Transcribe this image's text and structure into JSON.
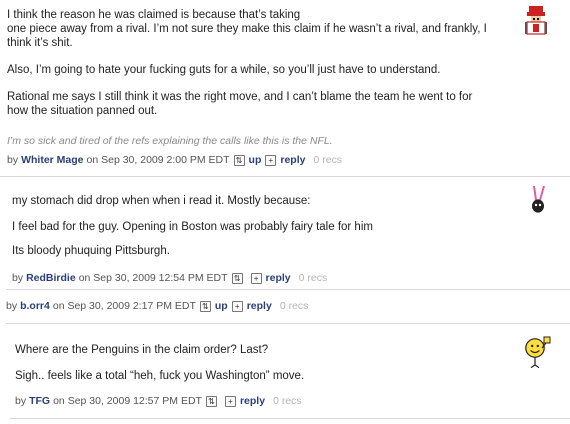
{
  "comments": [
    {
      "paragraphs": [
        "I think the reason he was claimed is because that’s taking",
        "one piece away from a rival. I’m not sure they make this claim if he wasn’t a rival, and frankly, I",
        "think it’s shit.",
        "Also, I’m going to hate your fucking guts for a while, so you’ll just have to understand.",
        "Rational me says I still think it was the right move, and I can’t blame the team he went to for",
        "how the situation panned out."
      ],
      "signature": "I’m so sick and tired of the refs explaining the calls like this is the NFL.",
      "meta": {
        "by": "by",
        "author": "Whiter Mage",
        "date": "on Sep 30, 2009 2:00 PM EDT",
        "up_icon": "⇅",
        "up": "up",
        "reply_icon": "+",
        "reply": "reply",
        "recs": "0 recs"
      },
      "avatar_icon": "pixel-mage-avatar-icon"
    },
    {
      "paragraphs": [
        "my stomach did drop when when i read it. Mostly because:",
        "I feel bad for the guy. Opening in Boston was probably fairy tale for him",
        "Its bloody phuquing Pittsburgh."
      ],
      "meta": {
        "by": "by",
        "author": "RedBirdie",
        "date": "on Sep 30, 2009 12:54 PM EDT",
        "up_icon": "⇅",
        "reply_icon": "+",
        "reply": "reply",
        "recs": "0 recs"
      },
      "avatar_icon": "pink-bunny-avatar-icon"
    },
    {
      "meta": {
        "by": "by",
        "author": "b.orr4",
        "date": "on Sep 30, 2009 2:17 PM EDT",
        "up_icon": "⇅",
        "up": "up",
        "reply_icon": "+",
        "reply": "reply",
        "recs": "0 recs"
      }
    },
    {
      "paragraphs": [
        "Where are the Penguins in the claim order? Last?",
        "Sigh.. feels like a total “heh, fuck you Washington” move."
      ],
      "meta": {
        "by": "by",
        "author": "TFG",
        "date": "on Sep 30, 2009 12:57 PM EDT",
        "up_icon": "⇅",
        "reply_icon": "+",
        "reply": "reply",
        "recs": "0 recs"
      },
      "avatar_icon": "smiley-fist-avatar-icon"
    }
  ],
  "colors": {
    "author_link": "#2a3f7a",
    "meta_text": "#555555",
    "recs": "#b5b5b5",
    "signature": "#8a8a8a",
    "divider": "#d9d9d9"
  }
}
